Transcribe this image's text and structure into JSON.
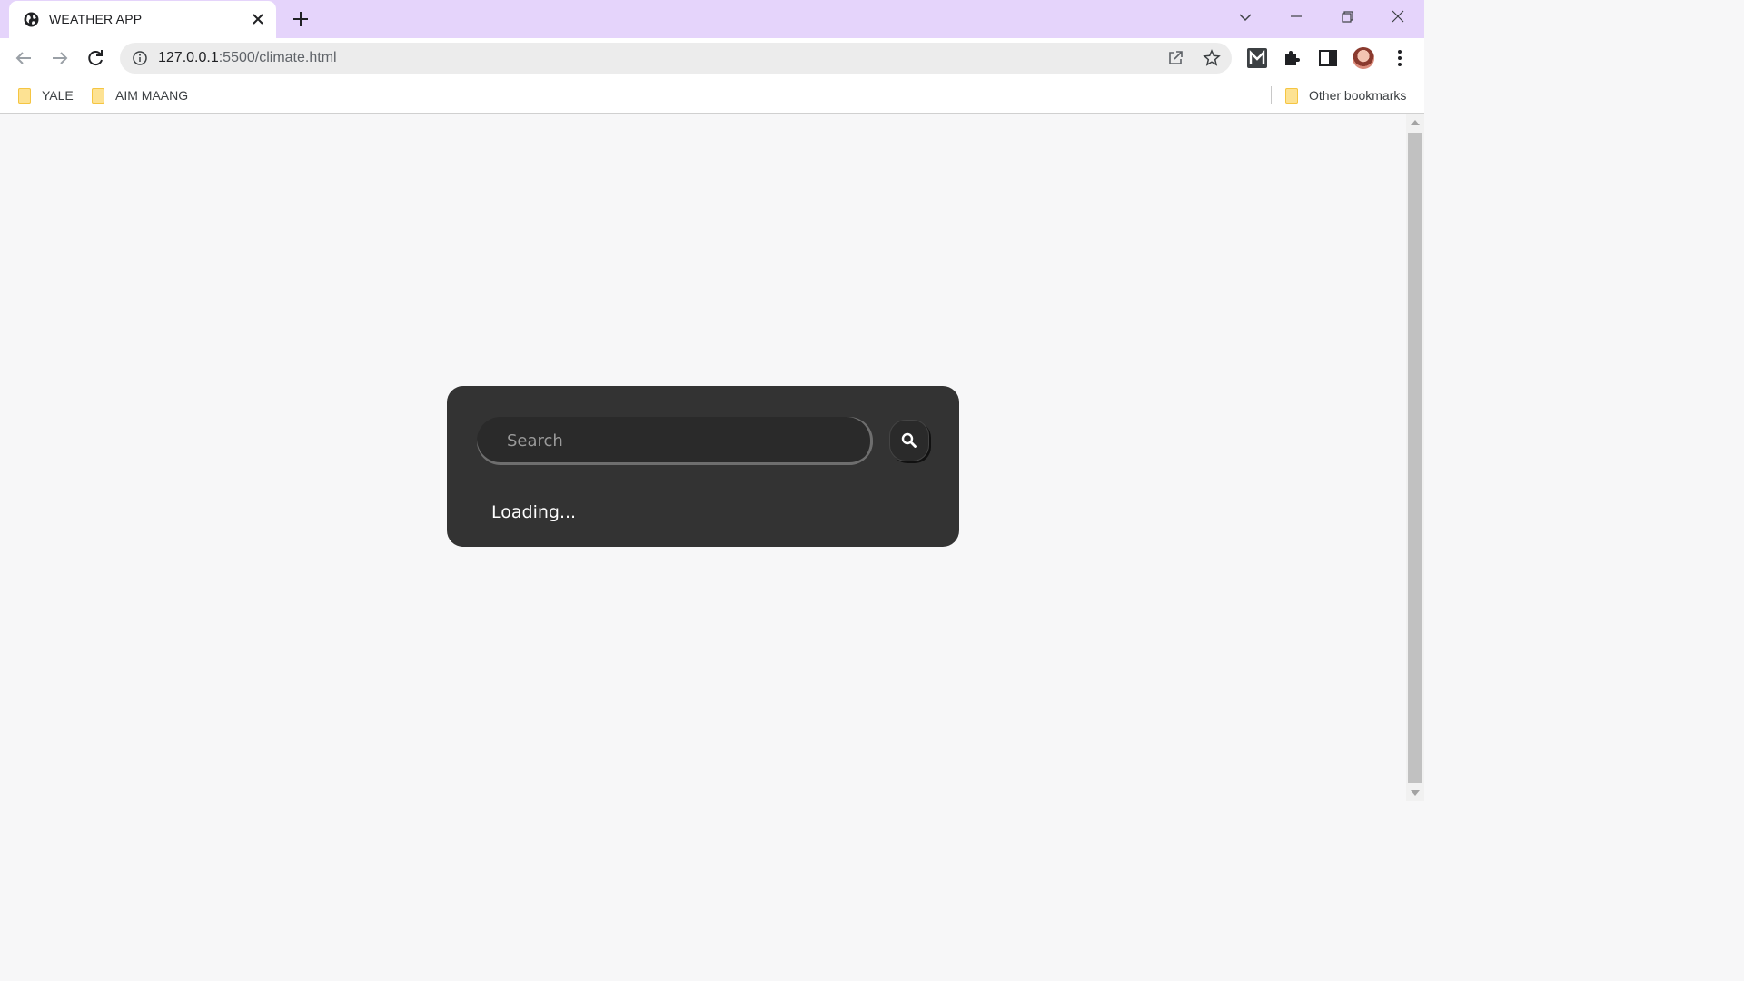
{
  "browser": {
    "tab": {
      "title": "WEATHER APP",
      "favicon": "globe-icon"
    },
    "address": {
      "host": "127.0.0.1",
      "path": ":5500/climate.html"
    },
    "bookmarks": [
      {
        "label": "YALE"
      },
      {
        "label": "AIM MAANG"
      }
    ],
    "other_bookmarks_label": "Other bookmarks",
    "colors": {
      "tabstrip": "#e5d4fb",
      "page_bg": "#f7f7f8"
    }
  },
  "app": {
    "search": {
      "placeholder": "Search",
      "value": ""
    },
    "search_button_icon": "search-icon",
    "status": "Loading...",
    "colors": {
      "card_bg": "#333333",
      "input_bg": "#2a2a2a",
      "text": "#ffffff"
    }
  }
}
